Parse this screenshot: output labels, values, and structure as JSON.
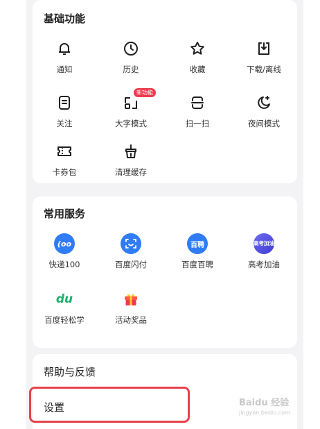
{
  "basic": {
    "title": "基础功能",
    "items": [
      {
        "label": "通知",
        "icon": "bell-icon"
      },
      {
        "label": "历史",
        "icon": "clock-icon"
      },
      {
        "label": "收藏",
        "icon": "star-icon"
      },
      {
        "label": "下载/离线",
        "icon": "download-icon"
      },
      {
        "label": "关注",
        "icon": "follow-icon"
      },
      {
        "label": "大字模式",
        "icon": "large-text-icon",
        "badge": "新功能"
      },
      {
        "label": "扫一扫",
        "icon": "scan-icon"
      },
      {
        "label": "夜间模式",
        "icon": "night-mode-icon"
      },
      {
        "label": "卡券包",
        "icon": "coupon-icon"
      },
      {
        "label": "清理缓存",
        "icon": "clean-cache-icon"
      }
    ]
  },
  "services": {
    "title": "常用服务",
    "items": [
      {
        "label": "快递100",
        "icon": "kuaidi100-icon",
        "glyph": "(oo"
      },
      {
        "label": "百度闪付",
        "icon": "baidu-pay-icon"
      },
      {
        "label": "百度百聘",
        "icon": "baidu-baipin-icon",
        "glyph": "百聘"
      },
      {
        "label": "高考加油",
        "icon": "gaokao-icon",
        "glyph": "高考加油"
      },
      {
        "label": "百度轻松学",
        "icon": "baidu-learn-icon",
        "glyph": "du"
      },
      {
        "label": "活动奖品",
        "icon": "gift-icon"
      }
    ]
  },
  "more": {
    "help_label": "帮助与反馈",
    "settings_label": "设置"
  },
  "watermark": {
    "brand": "Baidu 经验",
    "url": "jingyan.baidu.com"
  },
  "colors": {
    "accent": "#2f7cf6",
    "badge": "#f0394d",
    "highlight": "#e8424a"
  }
}
